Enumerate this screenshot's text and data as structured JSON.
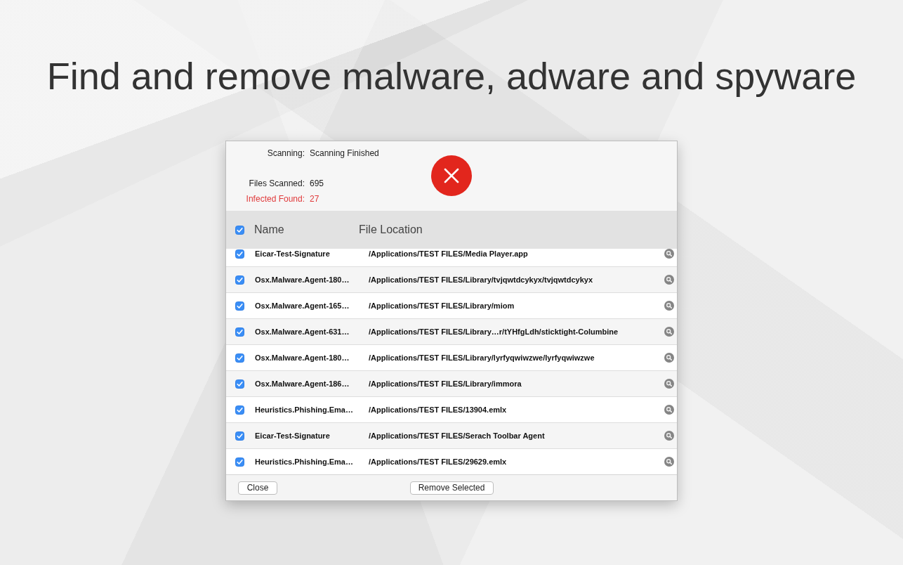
{
  "headline": "Find and remove malware, adware and spyware",
  "scan": {
    "status": {
      "label": "Scanning:",
      "value": "Scanning Finished"
    },
    "stats": [
      {
        "label": "Files Scanned:",
        "value": "695",
        "alert": false
      },
      {
        "label": "Infected Found:",
        "value": "27",
        "alert": true
      }
    ]
  },
  "table": {
    "all_checked": true,
    "columns": [
      "Name",
      "File Location"
    ],
    "rows": [
      {
        "name": "Eicar-Test-Signature",
        "location": "/Applications/TEST FILES/Media Player.app",
        "checked": true
      },
      {
        "name": "Osx.Malware.Agent-180…",
        "location": "/Applications/TEST FILES/Library/tvjqwtdcykyx/tvjqwtdcykyx",
        "checked": true
      },
      {
        "name": "Osx.Malware.Agent-165…",
        "location": "/Applications/TEST FILES/Library/miom",
        "checked": true
      },
      {
        "name": "Osx.Malware.Agent-631…",
        "location": "/Applications/TEST FILES/Library…r/tYHfgLdh/sticktight-Columbine",
        "checked": true
      },
      {
        "name": "Osx.Malware.Agent-180…",
        "location": "/Applications/TEST FILES/Library/lyrfyqwiwzwe/lyrfyqwiwzwe",
        "checked": true
      },
      {
        "name": "Osx.Malware.Agent-186…",
        "location": "/Applications/TEST FILES/Library/immora",
        "checked": true
      },
      {
        "name": "Heuristics.Phishing.Ema…",
        "location": "/Applications/TEST FILES/13904.emlx",
        "checked": true
      },
      {
        "name": "Eicar-Test-Signature",
        "location": "/Applications/TEST FILES/Serach Toolbar Agent",
        "checked": true
      },
      {
        "name": "Heuristics.Phishing.Ema…",
        "location": "/Applications/TEST FILES/29629.emlx",
        "checked": true
      }
    ]
  },
  "buttons": [
    {
      "label": "Close"
    },
    {
      "label": "Remove Selected"
    }
  ]
}
